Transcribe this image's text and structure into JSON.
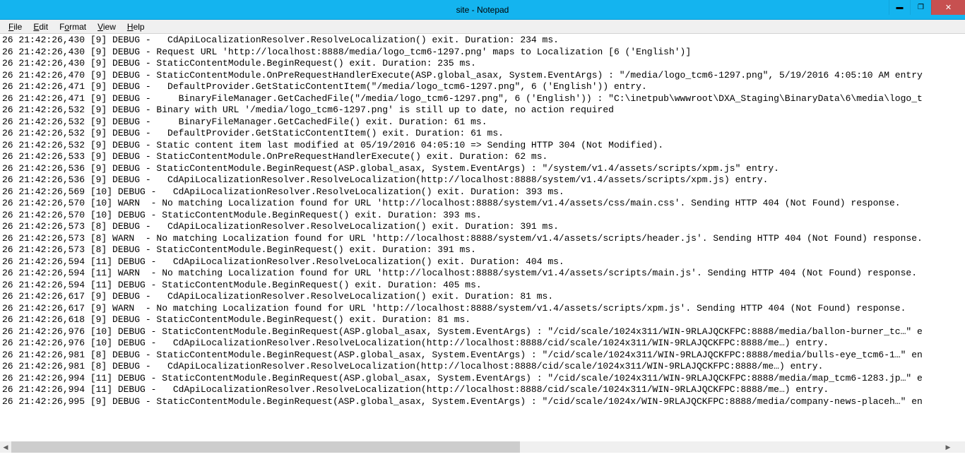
{
  "window": {
    "title": "site - Notepad"
  },
  "menu": {
    "file": "File",
    "edit": "Edit",
    "format": "Format",
    "view": "View",
    "help": "Help"
  },
  "log_lines": [
    "26 21:42:26,430 [9] DEBUG -   CdApiLocalizationResolver.ResolveLocalization() exit. Duration: 234 ms.",
    "26 21:42:26,430 [9] DEBUG - Request URL 'http://localhost:8888/media/logo_tcm6-1297.png' maps to Localization [6 ('English')]",
    "26 21:42:26,430 [9] DEBUG - StaticContentModule.BeginRequest() exit. Duration: 235 ms.",
    "26 21:42:26,470 [9] DEBUG - StaticContentModule.OnPreRequestHandlerExecute(ASP.global_asax, System.EventArgs) : \"/media/logo_tcm6-1297.png\", 5/19/2016 4:05:10 AM entry",
    "26 21:42:26,471 [9] DEBUG -   DefaultProvider.GetStaticContentItem(\"/media/logo_tcm6-1297.png\", 6 ('English')) entry.",
    "26 21:42:26,471 [9] DEBUG -     BinaryFileManager.GetCachedFile(\"/media/logo_tcm6-1297.png\", 6 ('English')) : \"C:\\inetpub\\wwwroot\\DXA_Staging\\BinaryData\\6\\media\\logo_t",
    "26 21:42:26,532 [9] DEBUG - Binary with URL '/media/logo_tcm6-1297.png' is still up to date, no action required",
    "26 21:42:26,532 [9] DEBUG -     BinaryFileManager.GetCachedFile() exit. Duration: 61 ms.",
    "26 21:42:26,532 [9] DEBUG -   DefaultProvider.GetStaticContentItem() exit. Duration: 61 ms.",
    "26 21:42:26,532 [9] DEBUG - Static content item last modified at 05/19/2016 04:05:10 => Sending HTTP 304 (Not Modified).",
    "26 21:42:26,533 [9] DEBUG - StaticContentModule.OnPreRequestHandlerExecute() exit. Duration: 62 ms.",
    "26 21:42:26,536 [9] DEBUG - StaticContentModule.BeginRequest(ASP.global_asax, System.EventArgs) : \"/system/v1.4/assets/scripts/xpm.js\" entry.",
    "26 21:42:26,536 [9] DEBUG -   CdApiLocalizationResolver.ResolveLocalization(http://localhost:8888/system/v1.4/assets/scripts/xpm.js) entry.",
    "26 21:42:26,569 [10] DEBUG -   CdApiLocalizationResolver.ResolveLocalization() exit. Duration: 393 ms.",
    "26 21:42:26,570 [10] WARN  - No matching Localization found for URL 'http://localhost:8888/system/v1.4/assets/css/main.css'. Sending HTTP 404 (Not Found) response.",
    "26 21:42:26,570 [10] DEBUG - StaticContentModule.BeginRequest() exit. Duration: 393 ms.",
    "26 21:42:26,573 [8] DEBUG -   CdApiLocalizationResolver.ResolveLocalization() exit. Duration: 391 ms.",
    "26 21:42:26,573 [8] WARN  - No matching Localization found for URL 'http://localhost:8888/system/v1.4/assets/scripts/header.js'. Sending HTTP 404 (Not Found) response.",
    "26 21:42:26,573 [8] DEBUG - StaticContentModule.BeginRequest() exit. Duration: 391 ms.",
    "26 21:42:26,594 [11] DEBUG -   CdApiLocalizationResolver.ResolveLocalization() exit. Duration: 404 ms.",
    "26 21:42:26,594 [11] WARN  - No matching Localization found for URL 'http://localhost:8888/system/v1.4/assets/scripts/main.js'. Sending HTTP 404 (Not Found) response.",
    "26 21:42:26,594 [11] DEBUG - StaticContentModule.BeginRequest() exit. Duration: 405 ms.",
    "26 21:42:26,617 [9] DEBUG -   CdApiLocalizationResolver.ResolveLocalization() exit. Duration: 81 ms.",
    "26 21:42:26,617 [9] WARN  - No matching Localization found for URL 'http://localhost:8888/system/v1.4/assets/scripts/xpm.js'. Sending HTTP 404 (Not Found) response.",
    "26 21:42:26,618 [9] DEBUG - StaticContentModule.BeginRequest() exit. Duration: 81 ms.",
    "26 21:42:26,976 [10] DEBUG - StaticContentModule.BeginRequest(ASP.global_asax, System.EventArgs) : \"/cid/scale/1024x311/WIN-9RLAJQCKFPC:8888/media/ballon-burner_tc…\" e",
    "26 21:42:26,976 [10] DEBUG -   CdApiLocalizationResolver.ResolveLocalization(http://localhost:8888/cid/scale/1024x311/WIN-9RLAJQCKFPC:8888/me…) entry.",
    "26 21:42:26,981 [8] DEBUG - StaticContentModule.BeginRequest(ASP.global_asax, System.EventArgs) : \"/cid/scale/1024x311/WIN-9RLAJQCKFPC:8888/media/bulls-eye_tcm6-1…\" en",
    "26 21:42:26,981 [8] DEBUG -   CdApiLocalizationResolver.ResolveLocalization(http://localhost:8888/cid/scale/1024x311/WIN-9RLAJQCKFPC:8888/me…) entry.",
    "26 21:42:26,994 [11] DEBUG - StaticContentModule.BeginRequest(ASP.global_asax, System.EventArgs) : \"/cid/scale/1024x311/WIN-9RLAJQCKFPC:8888/media/map_tcm6-1283.jp…\" e",
    "26 21:42:26,994 [11] DEBUG -   CdApiLocalizationResolver.ResolveLocalization(http://localhost:8888/cid/scale/1024x311/WIN-9RLAJQCKFPC:8888/me…) entry.",
    "26 21:42:26,995 [9] DEBUG - StaticContentModule.BeginRequest(ASP.global_asax, System.EventArgs) : \"/cid/scale/1024x/WIN-9RLAJQCKFPC:8888/media/company-news-placeh…\" en"
  ]
}
